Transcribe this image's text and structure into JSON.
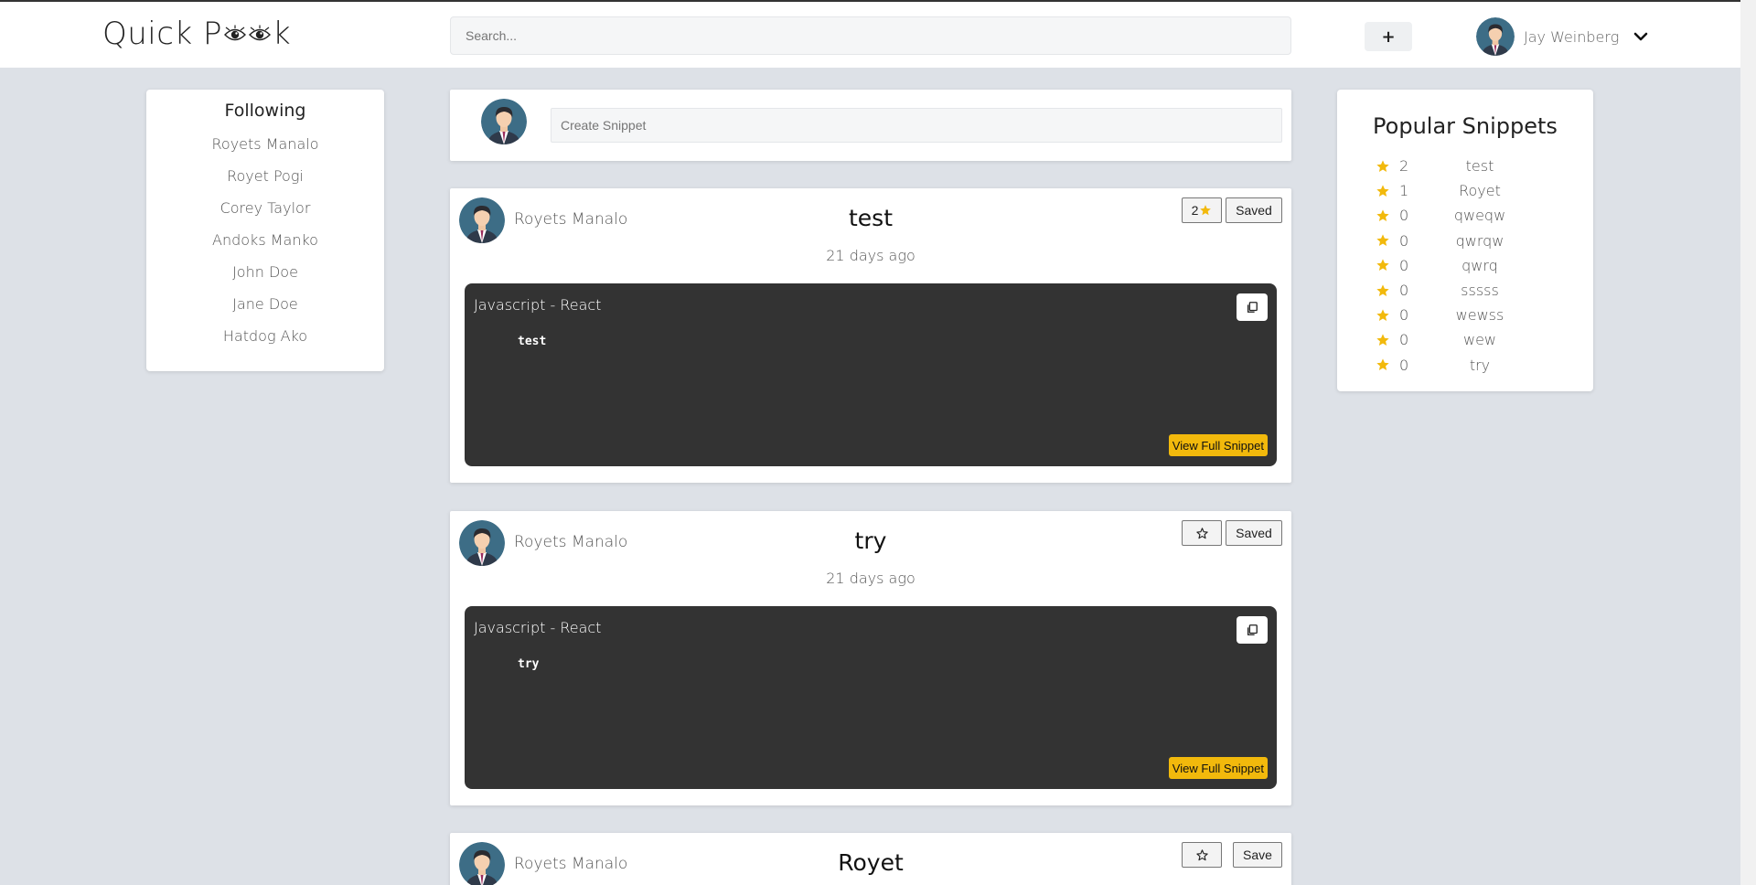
{
  "header": {
    "logo_prefix": "Quick P",
    "logo_suffix": "k",
    "search_placeholder": "Search...",
    "add_label": "+",
    "user_name": "Jay Weinberg"
  },
  "following": {
    "title": "Following",
    "items": [
      "Royets Manalo",
      "Royet Pogi",
      "Corey Taylor",
      "Andoks Manko",
      "John Doe",
      "Jane Doe",
      "Hatdog Ako"
    ]
  },
  "create": {
    "placeholder": "Create Snippet"
  },
  "posts": [
    {
      "author": "Royets Manalo",
      "title": "test",
      "time": "21 days ago",
      "star_count": "2",
      "save_label": "Saved",
      "language": "Javascript - React",
      "code": "test",
      "view_label": "View Full Snippet"
    },
    {
      "author": "Royets Manalo",
      "title": "try",
      "time": "21 days ago",
      "star_count": "",
      "save_label": "Saved",
      "language": "Javascript - React",
      "code": "try",
      "view_label": "View Full Snippet"
    },
    {
      "author": "Royets Manalo",
      "title": "Royet",
      "time": "",
      "star_count": "",
      "save_label": "Save",
      "language": "",
      "code": "",
      "view_label": ""
    }
  ],
  "popular": {
    "title": "Popular Snippets",
    "items": [
      {
        "count": "2",
        "name": "test"
      },
      {
        "count": "1",
        "name": "Royet"
      },
      {
        "count": "0",
        "name": "qweqw"
      },
      {
        "count": "0",
        "name": "qwrqw"
      },
      {
        "count": "0",
        "name": "qwrq"
      },
      {
        "count": "0",
        "name": "sssss"
      },
      {
        "count": "0",
        "name": "wewss"
      },
      {
        "count": "0",
        "name": "wew"
      },
      {
        "count": "0",
        "name": "try"
      }
    ]
  },
  "colors": {
    "accent": "#f2b90c",
    "code_bg": "#333333",
    "page_bg": "#dde1e7"
  },
  "icons": {
    "add": "plus-icon",
    "chevron": "chevron-down-icon",
    "star": "star-icon",
    "copy": "copy-icon"
  }
}
